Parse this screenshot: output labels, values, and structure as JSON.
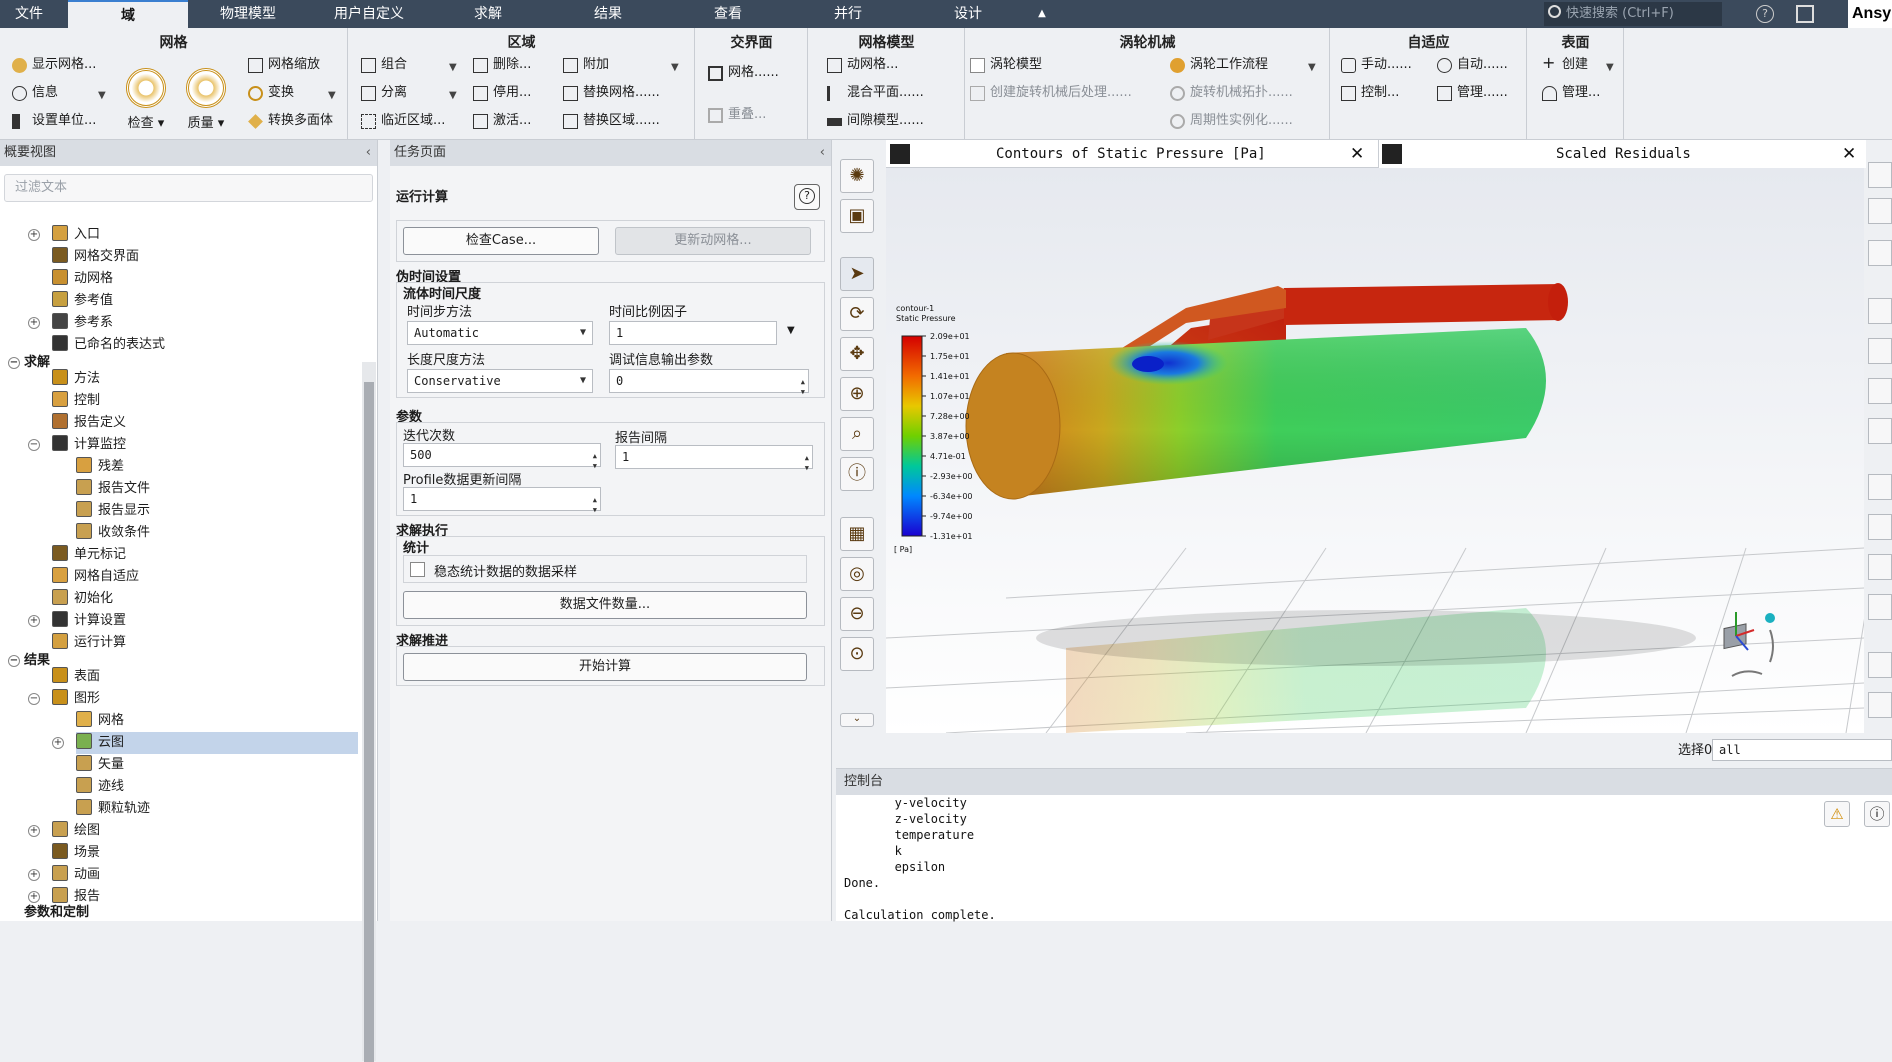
{
  "menubar": {
    "tabs": [
      "文件",
      "域",
      "物理模型",
      "用户自定义",
      "求解",
      "结果",
      "查看",
      "并行",
      "设计"
    ],
    "search_placeholder": "快速搜索 (Ctrl+F)",
    "brand": "Ansy"
  },
  "ribbon": {
    "mesh": {
      "title": "网格",
      "show_mesh": "显示网格...",
      "info": "信息",
      "units": "设置单位...",
      "check": "检查",
      "quality": "质量",
      "scale": "网格缩放",
      "transform": "变换",
      "convert": "转换多面体"
    },
    "zones": {
      "title": "区域",
      "combine": "组合",
      "separate": "分离",
      "adjacency": "临近区域...",
      "delete": "删除...",
      "deactivate": "停用...",
      "activate": "激活...",
      "append": "附加",
      "replace_mesh": "替换网格......",
      "replace_zone": "替换区域......"
    },
    "interfaces": {
      "title": "交界面",
      "mesh": "网格......",
      "overlap": "重叠..."
    },
    "mesh_models": {
      "title": "网格模型",
      "dynamic": "动网格...",
      "mixing": "混合平面......",
      "gap": "间隙模型......"
    },
    "turbo": {
      "title": "涡轮机械",
      "model": "涡轮模型",
      "create": "创建旋转机械后处理......",
      "workflow": "涡轮工作流程",
      "topology": "旋转机械拓扑......",
      "periodic": "周期性实例化......"
    },
    "adapt": {
      "title": "自适应",
      "manual": "手动......",
      "auto": "自动......",
      "control": "控制...",
      "manage": "管理......"
    },
    "surface": {
      "title": "表面",
      "create": "创建",
      "manage": "管理..."
    }
  },
  "outline": {
    "title": "概要视图",
    "filter_placeholder": "过滤文本",
    "items": [
      {
        "label": "入口",
        "bold": false
      },
      {
        "label": "网格交界面",
        "bold": false
      },
      {
        "label": "动网格",
        "bold": false
      },
      {
        "label": "参考值",
        "bold": false
      },
      {
        "label": "参考系",
        "bold": false
      },
      {
        "label": "已命名的表达式",
        "bold": false
      },
      {
        "label": "求解",
        "bold": true
      },
      {
        "label": "方法",
        "bold": false
      },
      {
        "label": "控制",
        "bold": false
      },
      {
        "label": "报告定义",
        "bold": false
      },
      {
        "label": "计算监控",
        "bold": false
      },
      {
        "label": "残差",
        "bold": false
      },
      {
        "label": "报告文件",
        "bold": false
      },
      {
        "label": "报告显示",
        "bold": false
      },
      {
        "label": "收敛条件",
        "bold": false
      },
      {
        "label": "单元标记",
        "bold": false
      },
      {
        "label": "网格自适应",
        "bold": false
      },
      {
        "label": "初始化",
        "bold": false
      },
      {
        "label": "计算设置",
        "bold": false
      },
      {
        "label": "运行计算",
        "bold": false
      },
      {
        "label": "结果",
        "bold": true
      },
      {
        "label": "表面",
        "bold": false
      },
      {
        "label": "图形",
        "bold": false
      },
      {
        "label": "网格",
        "bold": false
      },
      {
        "label": "云图",
        "bold": false
      },
      {
        "label": "矢量",
        "bold": false
      },
      {
        "label": "迹线",
        "bold": false
      },
      {
        "label": "颗粒轨迹",
        "bold": false
      },
      {
        "label": "绘图",
        "bold": false
      },
      {
        "label": "场景",
        "bold": false
      },
      {
        "label": "动画",
        "bold": false
      },
      {
        "label": "报告",
        "bold": false
      },
      {
        "label": "参数和定制",
        "bold": true
      }
    ]
  },
  "task": {
    "title": "任务页面",
    "heading": "运行计算",
    "help": "?",
    "check_case": "检查Case...",
    "update_mesh": "更新动网格...",
    "pseudo_time": "伪时间设置",
    "fluid_timescale": "流体时间尺度",
    "time_step_method": "时间步方法",
    "time_step_value": "Automatic",
    "time_scale_factor": "时间比例因子",
    "time_scale_value": "1",
    "length_scale_method": "长度尺度方法",
    "length_scale_value": "Conservative",
    "verbosity": "调试信息输出参数",
    "verbosity_value": "0",
    "params": "参数",
    "iterations": "迭代次数",
    "iterations_value": "500",
    "report_interval": "报告间隔",
    "report_interval_value": "1",
    "profile_interval": "Profile数据更新间隔",
    "profile_interval_value": "1",
    "solve_exec": "求解执行",
    "stats": "统计",
    "stats_checkbox": "稳态统计数据的数据采样",
    "data_file_qty": "数据文件数量...",
    "solve_advance": "求解推进",
    "start": "开始计算"
  },
  "graphics": {
    "tab1": "Contours of Static Pressure [Pa]",
    "tab2": "Scaled Residuals",
    "contour_name": "contour-1",
    "contour_var": "Static Pressure",
    "unit": "[ Pa]",
    "legend_values": [
      "2.09e+01",
      "1.75e+01",
      "1.41e+01",
      "1.07e+01",
      "7.28e+00",
      "3.87e+00",
      "4.71e-01",
      "-2.93e+00",
      "-6.34e+00",
      "-9.74e+00",
      "-1.31e+01"
    ],
    "select_label": "选择0",
    "select_value": "all"
  },
  "console": {
    "title": "控制台",
    "lines": [
      "       y-velocity",
      "       z-velocity",
      "       temperature",
      "       k",
      "       epsilon",
      "Done.",
      "",
      "Calculation complete."
    ]
  }
}
